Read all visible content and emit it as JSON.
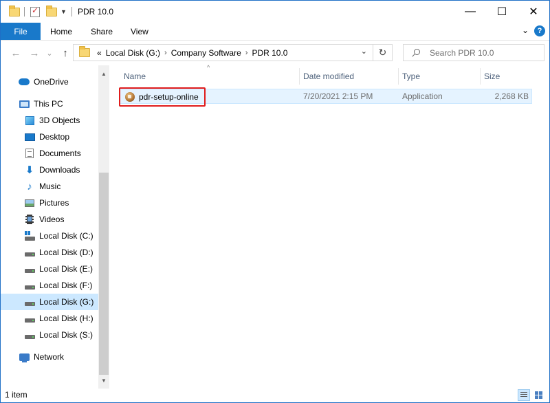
{
  "window": {
    "title": "PDR 10.0",
    "minimize_glyph": "—",
    "maximize_glyph": "☐",
    "close_glyph": "✕"
  },
  "ribbon": {
    "tabs": [
      "File",
      "Home",
      "Share",
      "View"
    ],
    "expand_glyph": "⌄",
    "help_glyph": "?"
  },
  "nav": {
    "back_glyph": "←",
    "forward_glyph": "→",
    "history_glyph": "⌄",
    "up_glyph": "↑",
    "breadcrumb_overflow": "«",
    "breadcrumbs": [
      "Local Disk (G:)",
      "Company Software",
      "PDR 10.0"
    ],
    "crumb_separator": "›",
    "dropdown_glyph": "⌄",
    "refresh_glyph": "↻",
    "search_placeholder": "Search PDR 10.0"
  },
  "sidebar": {
    "items": [
      {
        "label": "OneDrive",
        "icon": "onedrive-icon"
      },
      {
        "label": "This PC",
        "icon": "this-pc-icon"
      },
      {
        "label": "3D Objects",
        "icon": "3d-objects-icon"
      },
      {
        "label": "Desktop",
        "icon": "desktop-icon"
      },
      {
        "label": "Documents",
        "icon": "documents-icon"
      },
      {
        "label": "Downloads",
        "icon": "downloads-icon"
      },
      {
        "label": "Music",
        "icon": "music-icon"
      },
      {
        "label": "Pictures",
        "icon": "pictures-icon"
      },
      {
        "label": "Videos",
        "icon": "videos-icon"
      },
      {
        "label": "Local Disk (C:)",
        "icon": "system-drive-icon"
      },
      {
        "label": "Local Disk (D:)",
        "icon": "drive-icon"
      },
      {
        "label": "Local Disk (E:)",
        "icon": "drive-icon"
      },
      {
        "label": "Local Disk (F:)",
        "icon": "drive-icon"
      },
      {
        "label": "Local Disk (G:)",
        "icon": "drive-icon",
        "selected": true
      },
      {
        "label": "Local Disk (H:)",
        "icon": "drive-icon"
      },
      {
        "label": "Local Disk (S:)",
        "icon": "drive-icon"
      },
      {
        "label": "Network",
        "icon": "network-icon"
      }
    ],
    "scroll_up_glyph": "▲",
    "scroll_down_glyph": "▼"
  },
  "file_list": {
    "sort_glyph": "^",
    "columns": [
      "Name",
      "Date modified",
      "Type",
      "Size"
    ],
    "rows": [
      {
        "name": "pdr-setup-online",
        "date_modified": "7/20/2021 2:15 PM",
        "type": "Application",
        "size": "2,268 KB",
        "icon": "application-icon"
      }
    ]
  },
  "status": {
    "item_count": "1 item"
  },
  "colors": {
    "accent": "#1979ca",
    "selection": "#cce8ff",
    "highlight_box": "#e01b1b"
  }
}
